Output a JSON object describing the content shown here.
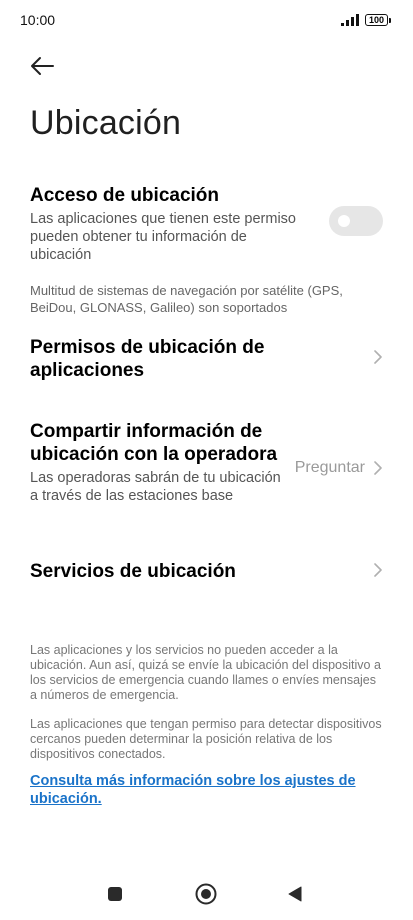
{
  "status_bar": {
    "time": "10:00",
    "battery": "100"
  },
  "page": {
    "title": "Ubicación"
  },
  "location_access": {
    "title": "Acceso de ubicación",
    "description": "Las aplicaciones que tienen este permiso pueden obtener tu información de ubicación",
    "enabled": false
  },
  "gnss_note": "Multitud de sistemas de navegación por satélite (GPS, BeiDou, GLONASS, Galileo) son soportados",
  "app_permissions": {
    "title": "Permisos de ubicación de aplicaciones"
  },
  "carrier_sharing": {
    "title": "Compartir información de ubicación con la operadora",
    "description": "Las operadoras sabrán de tu ubicación a través de las estaciones base",
    "value": "Preguntar"
  },
  "location_services": {
    "title": "Servicios de ubicación"
  },
  "footer": {
    "paragraph1": "Las aplicaciones y los servicios no pueden acceder a la ubicación. Aun así, quizá se envíe la ubicación del dispositivo a los servicios de emergencia cuando llames o envíes mensajes a números de emergencia.",
    "paragraph2": "Las aplicaciones que tengan permiso para detectar dispositivos cercanos pueden determinar la posición relativa de los dispositivos conectados.",
    "link": "Consulta más información sobre los ajustes de ubicación."
  },
  "colors": {
    "link": "#1a73c9",
    "toggle_off": "#e6e6e6",
    "secondary_text": "#555555"
  }
}
